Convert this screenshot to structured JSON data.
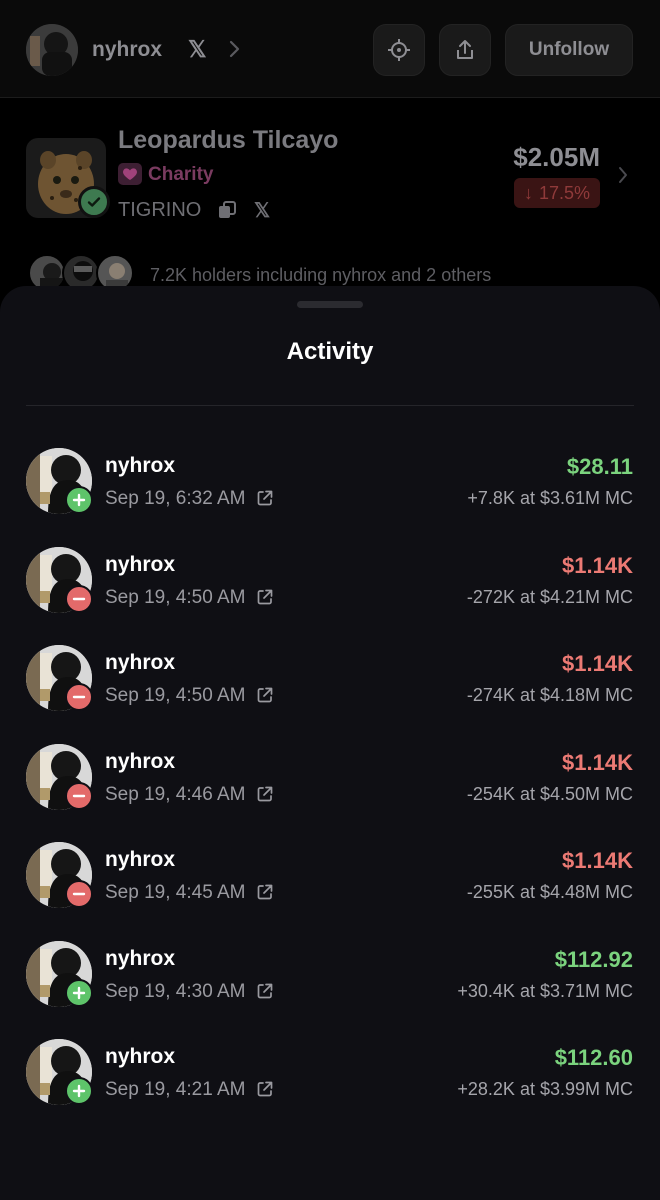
{
  "header": {
    "username": "nyhrox",
    "x_symbol": "𝕏",
    "unfollow_label": "Unfollow"
  },
  "token": {
    "name": "Leopardus Tilcayo",
    "category": "Charity",
    "ticker": "TIGRINO",
    "market_cap": "$2.05M",
    "change": "17.5%",
    "change_arrow": "↓",
    "holders_text": "7.2K holders including nyhrox  and 2 others"
  },
  "sheet": {
    "title": "Activity"
  },
  "activity": [
    {
      "user": "nyhrox",
      "time": "Sep 19, 6:32 AM",
      "type": "buy",
      "amount": "$28.11",
      "detail": "+7.8K at $3.61M MC"
    },
    {
      "user": "nyhrox",
      "time": "Sep 19, 4:50 AM",
      "type": "sell",
      "amount": "$1.14K",
      "detail": "-272K at $4.21M MC"
    },
    {
      "user": "nyhrox",
      "time": "Sep 19, 4:50 AM",
      "type": "sell",
      "amount": "$1.14K",
      "detail": "-274K at $4.18M MC"
    },
    {
      "user": "nyhrox",
      "time": "Sep 19, 4:46 AM",
      "type": "sell",
      "amount": "$1.14K",
      "detail": "-254K at $4.50M MC"
    },
    {
      "user": "nyhrox",
      "time": "Sep 19, 4:45 AM",
      "type": "sell",
      "amount": "$1.14K",
      "detail": "-255K at $4.48M MC"
    },
    {
      "user": "nyhrox",
      "time": "Sep 19, 4:30 AM",
      "type": "buy",
      "amount": "$112.92",
      "detail": "+30.4K at $3.71M MC"
    },
    {
      "user": "nyhrox",
      "time": "Sep 19, 4:21 AM",
      "type": "buy",
      "amount": "$112.60",
      "detail": "+28.2K at $3.99M MC"
    }
  ],
  "colors": {
    "buy": "#7bd37e",
    "sell": "#ec7a74",
    "sheet_bg": "#0f0f14"
  },
  "icons": {
    "row_badge_buy": "plus-icon",
    "row_badge_sell": "minus-icon",
    "row_link": "external-link-icon"
  }
}
